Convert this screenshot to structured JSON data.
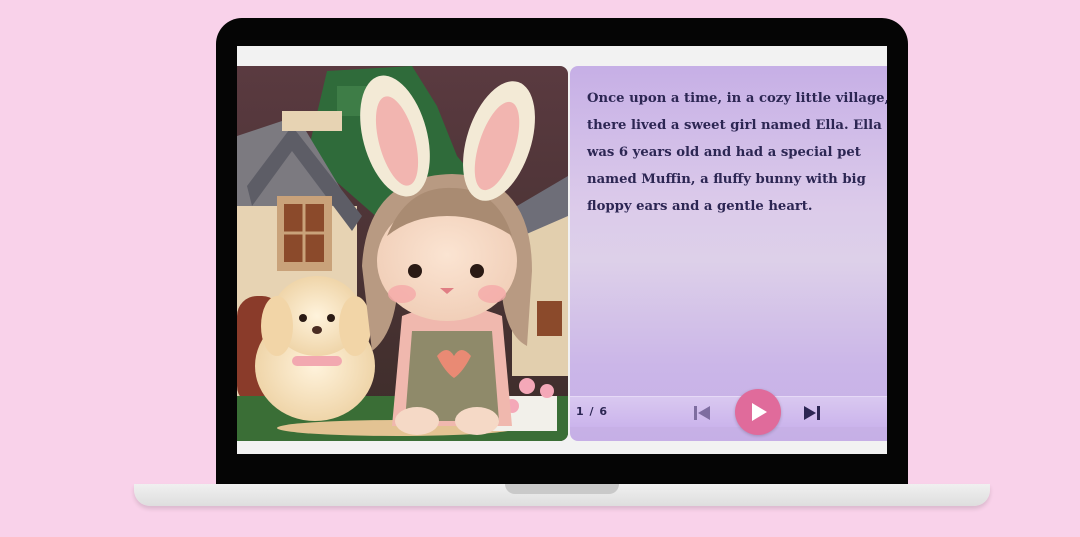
{
  "story": {
    "text": "Once upon a time, in a cozy little village, there lived a sweet girl named Ella. Ella was 6 years old and had a special pet named Muffin, a fluffy bunny with big floppy ears and a gentle heart."
  },
  "player": {
    "page_counter": "1 / 6",
    "accent_color": "#e06b9b",
    "prev_icon": "skip-previous-icon",
    "play_icon": "play-icon",
    "next_icon": "skip-next-icon"
  },
  "illustration": {
    "subject": "girl-with-bunny-ears-and-plush-puppy",
    "palette": [
      "#6f3b45",
      "#2f6b3a",
      "#e8c9a6",
      "#f3b6b0",
      "#9b8c6b"
    ]
  }
}
